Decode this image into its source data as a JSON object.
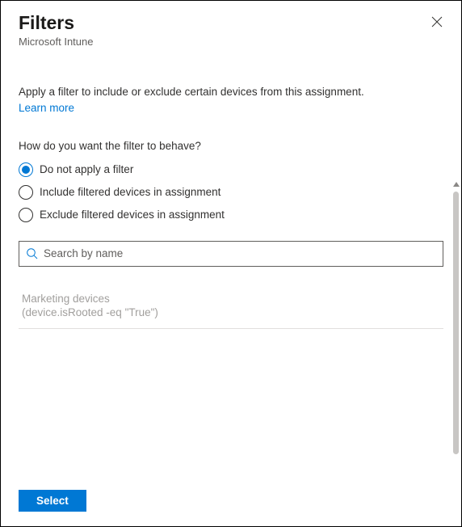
{
  "header": {
    "title": "Filters",
    "subtitle": "Microsoft Intune"
  },
  "body": {
    "description": "Apply a filter to include or exclude certain devices from this assignment.",
    "learn_more": "Learn more",
    "question": "How do you want the filter to behave?"
  },
  "options": [
    {
      "label": "Do not apply a filter",
      "selected": true
    },
    {
      "label": "Include filtered devices in assignment",
      "selected": false
    },
    {
      "label": "Exclude filtered devices in assignment",
      "selected": false
    }
  ],
  "search": {
    "placeholder": "Search by name",
    "value": ""
  },
  "filters": [
    {
      "name": "Marketing devices",
      "rule": "(device.isRooted -eq \"True\")"
    }
  ],
  "footer": {
    "select_label": "Select"
  }
}
